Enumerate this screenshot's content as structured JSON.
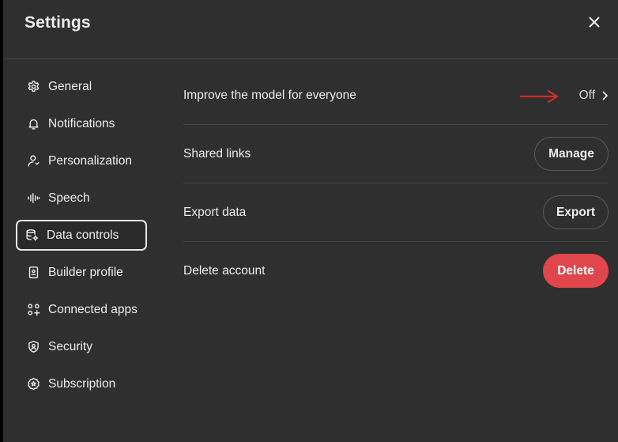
{
  "dialog": {
    "title": "Settings",
    "close_icon": "close-icon"
  },
  "sidebar": {
    "items": [
      {
        "label": "General",
        "icon": "gear-icon"
      },
      {
        "label": "Notifications",
        "icon": "bell-icon"
      },
      {
        "label": "Personalization",
        "icon": "person-icon"
      },
      {
        "label": "Speech",
        "icon": "waveform-icon"
      },
      {
        "label": "Data controls",
        "icon": "database-gear-icon",
        "active": true
      },
      {
        "label": "Builder profile",
        "icon": "id-card-icon"
      },
      {
        "label": "Connected apps",
        "icon": "apps-grid-icon"
      },
      {
        "label": "Security",
        "icon": "shield-icon"
      },
      {
        "label": "Subscription",
        "icon": "badge-icon"
      }
    ]
  },
  "settings": {
    "improve_model": {
      "label": "Improve the model for everyone",
      "value": "Off"
    },
    "shared_links": {
      "label": "Shared links",
      "button": "Manage"
    },
    "export_data": {
      "label": "Export data",
      "button": "Export"
    },
    "delete_account": {
      "label": "Delete account",
      "button": "Delete"
    }
  },
  "colors": {
    "background": "#2f2f2f",
    "text": "#ececec",
    "divider": "#454545",
    "danger": "#e0464b",
    "annotation_arrow": "#d42a2a"
  }
}
